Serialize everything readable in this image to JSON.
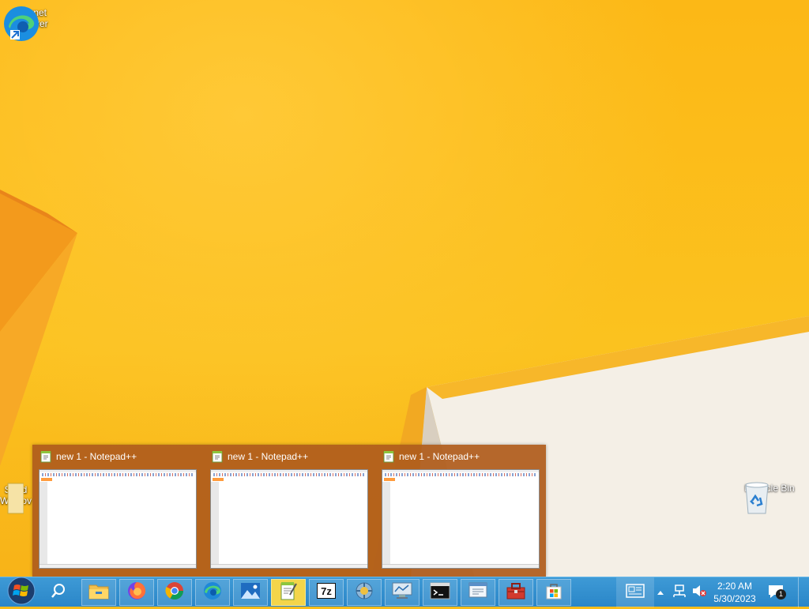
{
  "desktop": {
    "icons": [
      {
        "name": "internet-explorer",
        "label_line1": "internet",
        "label_line2": "explorer"
      },
      {
        "name": "start-windows",
        "label_line1": "Stard",
        "label_line2": "Windov"
      },
      {
        "name": "recycle-bin",
        "label_line1": "Recycle Bin",
        "label_line2": ""
      }
    ]
  },
  "preview": {
    "windows": [
      {
        "title": "new 1 - Notepad++"
      },
      {
        "title": "new 1 - Notepad++"
      },
      {
        "title": "new 1 - Notepad++"
      }
    ]
  },
  "taskbar": {
    "buttons": [
      {
        "icon": "windows-start-icon"
      },
      {
        "icon": "search-icon"
      },
      {
        "icon": "file-explorer-icon"
      },
      {
        "icon": "firefox-icon"
      },
      {
        "icon": "chrome-icon"
      },
      {
        "icon": "edge-icon"
      },
      {
        "icon": "photos-icon"
      },
      {
        "icon": "notepad-plus-plus-icon"
      },
      {
        "icon": "7zip-icon"
      },
      {
        "icon": "system-tool-icon"
      },
      {
        "icon": "monitor-app-icon"
      },
      {
        "icon": "command-prompt-icon"
      },
      {
        "icon": "document-viewer-icon"
      },
      {
        "icon": "toolbox-icon"
      },
      {
        "icon": "store-icon"
      }
    ],
    "tray": {
      "time": "2:20 AM",
      "date": "5/30/2023",
      "notification_count": "1"
    }
  },
  "colors": {
    "accent": "#2a86c8",
    "desktop": "#fbbd1a",
    "preview_bg": "#af5c1c",
    "active_button": "#f4d54a"
  }
}
